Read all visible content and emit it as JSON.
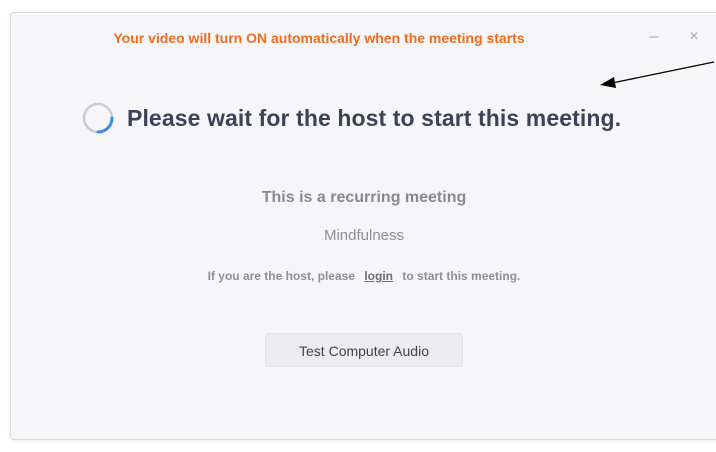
{
  "notice": {
    "text": "Your video will turn ON automatically when the meeting starts",
    "color": "#f26b1d"
  },
  "window_controls": {
    "minimize": "–",
    "close": "×"
  },
  "status": {
    "icon": "loading-spinner-icon",
    "heading": "Please wait for the host to start this meeting."
  },
  "meeting": {
    "type_label": "This is a recurring meeting",
    "name": "Mindfulness"
  },
  "host_prompt": {
    "before": "If you are the host, please",
    "link": "login",
    "after": "to start this meeting."
  },
  "buttons": {
    "test_audio": "Test Computer Audio"
  },
  "annotation": {
    "icon": "arrow-pointer-icon"
  },
  "colors": {
    "accent": "#f26b1d",
    "heading": "#3c4358",
    "spinner": "#3a8ee6"
  }
}
